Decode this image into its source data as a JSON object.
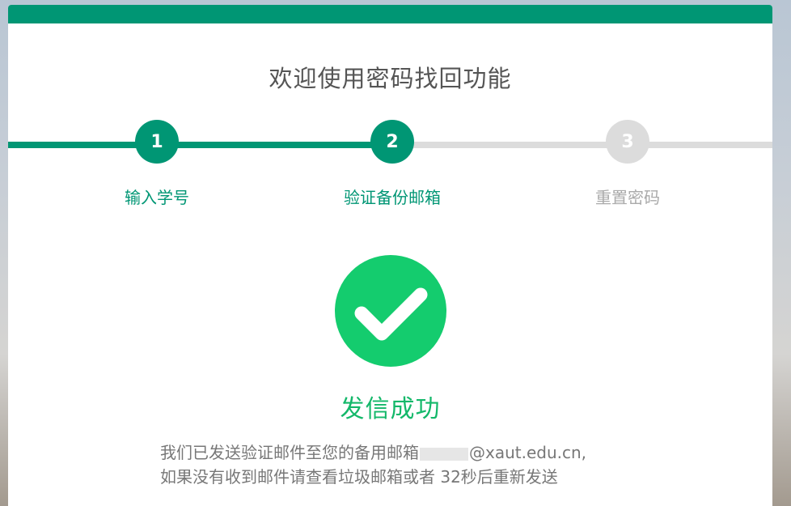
{
  "page": {
    "title": "欢迎使用密码找回功能"
  },
  "steps": [
    {
      "number": "1",
      "label": "输入学号",
      "state": "done"
    },
    {
      "number": "2",
      "label": "验证备份邮箱",
      "state": "current"
    },
    {
      "number": "3",
      "label": "重置密码",
      "state": "pending"
    }
  ],
  "result": {
    "icon": "check-circle-icon",
    "title": "发信成功",
    "message_line1_prefix": "我们已发送验证邮件至您的备用邮箱",
    "email_domain": "@xaut.edu.cn,",
    "message_line2_prefix": "如果没有收到邮件请查看垃圾邮箱或者",
    "countdown_text": "32秒后重新发送"
  },
  "colors": {
    "primary": "#009674",
    "success": "#14cc6e",
    "inactive": "#dcdcdc"
  }
}
